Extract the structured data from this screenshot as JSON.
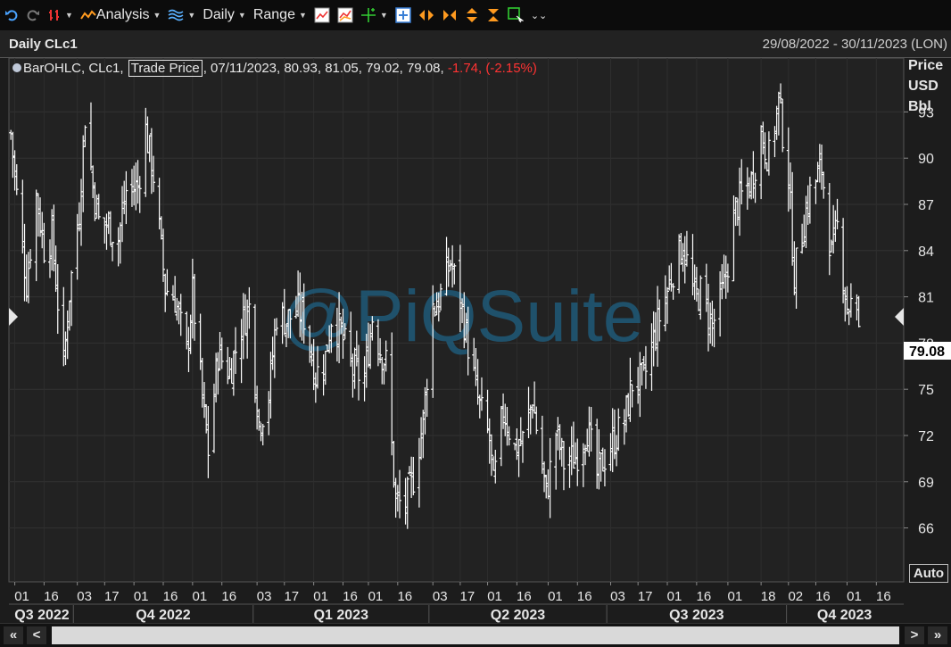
{
  "toolbar": {
    "analysis_label": "Analysis",
    "interval_label": "Daily",
    "range_label": "Range"
  },
  "header": {
    "title": "Daily CLc1",
    "date_range": "29/08/2022 - 30/11/2023 (LON)"
  },
  "legend": {
    "prefix": "BarOHLC, CLc1, ",
    "field": "Trade Price",
    "values": ", 07/11/2023, 80.93, 81.05, 79.02, 79.08, ",
    "change": "-1.74, (-2.15%)"
  },
  "axis": {
    "unit_lines": [
      "Price",
      "USD",
      "Bbl"
    ],
    "last_price": "79.08",
    "auto_label": "Auto"
  },
  "watermark": "@PiQSuite",
  "bottom": {
    "first": "«",
    "prev": "<",
    "next": ">",
    "last": "»"
  },
  "colors": {
    "background": "#1c1c1c",
    "bars": "#ffffff",
    "negative": "#ff3333",
    "watermark": "#1f5a78"
  },
  "chart_data": {
    "type": "bar",
    "style": "OHLC",
    "instrument": "CLc1",
    "x_start": "2022-08-29",
    "x_end": "2023-11-30",
    "ylim": [
      62.5,
      96.5
    ],
    "y_ticks": [
      66,
      69,
      72,
      75,
      78,
      81,
      84,
      87,
      90,
      93
    ],
    "x_tick_labels": [
      "01",
      "16",
      "03",
      "17",
      "01",
      "16",
      "01",
      "16",
      "03",
      "17",
      "01",
      "16",
      "01",
      "16",
      "03",
      "17",
      "01",
      "16",
      "01",
      "16",
      "03",
      "17",
      "01",
      "16",
      "01",
      "18",
      "02",
      "16",
      "01",
      "16"
    ],
    "quarter_labels": [
      "Q3 2022",
      "Q4 2022",
      "Q1 2023",
      "Q2 2023",
      "Q3 2023",
      "Q4 2023"
    ],
    "grid": true,
    "points": [
      [
        "2022-08-30",
        91.6
      ],
      [
        "2022-09-02",
        87.6
      ],
      [
        "2022-09-07",
        81.9
      ],
      [
        "2022-09-12",
        87.6
      ],
      [
        "2022-09-16",
        84.2
      ],
      [
        "2022-09-20",
        84.9
      ],
      [
        "2022-09-26",
        76.5
      ],
      [
        "2022-09-29",
        81.3
      ],
      [
        "2022-10-04",
        86.6
      ],
      [
        "2022-10-07",
        92.8
      ],
      [
        "2022-10-11",
        88.2
      ],
      [
        "2022-10-14",
        85.9
      ],
      [
        "2022-10-19",
        85.6
      ],
      [
        "2022-10-24",
        84.8
      ],
      [
        "2022-10-28",
        87.9
      ],
      [
        "2022-11-03",
        88.2
      ],
      [
        "2022-11-07",
        91.8
      ],
      [
        "2022-11-11",
        88.9
      ],
      [
        "2022-11-17",
        81.6
      ],
      [
        "2022-11-22",
        80.9
      ],
      [
        "2022-11-28",
        77.2
      ],
      [
        "2022-12-01",
        81.2
      ],
      [
        "2022-12-06",
        74.3
      ],
      [
        "2022-12-09",
        71.0
      ],
      [
        "2022-12-14",
        77.3
      ],
      [
        "2022-12-20",
        76.1
      ],
      [
        "2022-12-27",
        79.5
      ],
      [
        "2022-12-30",
        80.3
      ],
      [
        "2023-01-04",
        72.8
      ],
      [
        "2023-01-09",
        74.6
      ],
      [
        "2023-01-13",
        79.9
      ],
      [
        "2023-01-18",
        79.5
      ],
      [
        "2023-01-24",
        80.1
      ],
      [
        "2023-01-27",
        79.7
      ],
      [
        "2023-02-02",
        75.9
      ],
      [
        "2023-02-07",
        77.1
      ],
      [
        "2023-02-10",
        79.7
      ],
      [
        "2023-02-15",
        78.6
      ],
      [
        "2023-02-21",
        76.2
      ],
      [
        "2023-02-27",
        75.7
      ],
      [
        "2023-03-03",
        79.7
      ],
      [
        "2023-03-07",
        77.6
      ],
      [
        "2023-03-10",
        76.7
      ],
      [
        "2023-03-15",
        67.6
      ],
      [
        "2023-03-20",
        67.6
      ],
      [
        "2023-03-24",
        69.3
      ],
      [
        "2023-03-29",
        72.9
      ],
      [
        "2023-04-03",
        80.4
      ],
      [
        "2023-04-06",
        80.7
      ],
      [
        "2023-04-12",
        83.3
      ],
      [
        "2023-04-17",
        80.8
      ],
      [
        "2023-04-21",
        77.9
      ],
      [
        "2023-04-26",
        74.3
      ],
      [
        "2023-05-02",
        71.7
      ],
      [
        "2023-05-04",
        68.6
      ],
      [
        "2023-05-09",
        73.7
      ],
      [
        "2023-05-15",
        71.1
      ],
      [
        "2023-05-19",
        71.7
      ],
      [
        "2023-05-24",
        74.3
      ],
      [
        "2023-05-31",
        68.1
      ],
      [
        "2023-06-05",
        72.2
      ],
      [
        "2023-06-09",
        70.2
      ],
      [
        "2023-06-15",
        70.6
      ],
      [
        "2023-06-21",
        72.5
      ],
      [
        "2023-06-26",
        69.4
      ],
      [
        "2023-06-30",
        70.6
      ],
      [
        "2023-07-05",
        71.8
      ],
      [
        "2023-07-10",
        72.9
      ],
      [
        "2023-07-14",
        75.4
      ],
      [
        "2023-07-20",
        75.6
      ],
      [
        "2023-07-26",
        78.8
      ],
      [
        "2023-08-01",
        81.4
      ],
      [
        "2023-08-04",
        82.8
      ],
      [
        "2023-08-09",
        84.4
      ],
      [
        "2023-08-15",
        80.9
      ],
      [
        "2023-08-18",
        81.3
      ],
      [
        "2023-08-24",
        79.1
      ],
      [
        "2023-08-30",
        81.6
      ],
      [
        "2023-09-05",
        86.7
      ],
      [
        "2023-09-08",
        87.5
      ],
      [
        "2023-09-13",
        88.5
      ],
      [
        "2023-09-18",
        91.5
      ],
      [
        "2023-09-22",
        90.0
      ],
      [
        "2023-09-27",
        93.7
      ],
      [
        "2023-10-02",
        88.8
      ],
      [
        "2023-10-05",
        82.3
      ],
      [
        "2023-10-10",
        86.0
      ],
      [
        "2023-10-13",
        87.7
      ],
      [
        "2023-10-19",
        89.4
      ],
      [
        "2023-10-24",
        83.7
      ],
      [
        "2023-10-27",
        85.5
      ],
      [
        "2023-11-01",
        80.4
      ],
      [
        "2023-11-03",
        80.5
      ],
      [
        "2023-11-07",
        79.08
      ]
    ]
  }
}
